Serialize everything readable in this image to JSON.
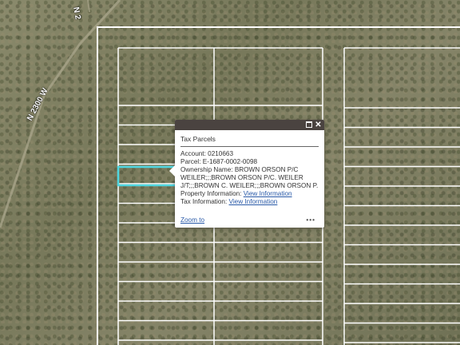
{
  "map": {
    "road_labels": [
      "N 2300 W",
      "N 2"
    ],
    "highlight_color": "#4fd6e0",
    "parcel_line_color": "#ffffff"
  },
  "popup": {
    "title": "Tax Parcels",
    "account_label": "Account:",
    "account_value": "0210663",
    "parcel_label": "Parcel:",
    "parcel_value": "E-1687-0002-0098",
    "ownership_label": "Ownership Name:",
    "ownership_value": "BROWN ORSON P/C WEILER;;;BROWN ORSON P/C. WEILER J/T;;;BROWN C. WEILER;;;BROWN ORSON P.",
    "property_label": "Property Information:",
    "property_link": "View Information",
    "tax_label": "Tax Information:",
    "tax_link": "View Information",
    "zoom_label": "Zoom to",
    "more_label": "•••",
    "icons": [
      "maximize-icon",
      "close-icon",
      "more-options-icon"
    ]
  }
}
